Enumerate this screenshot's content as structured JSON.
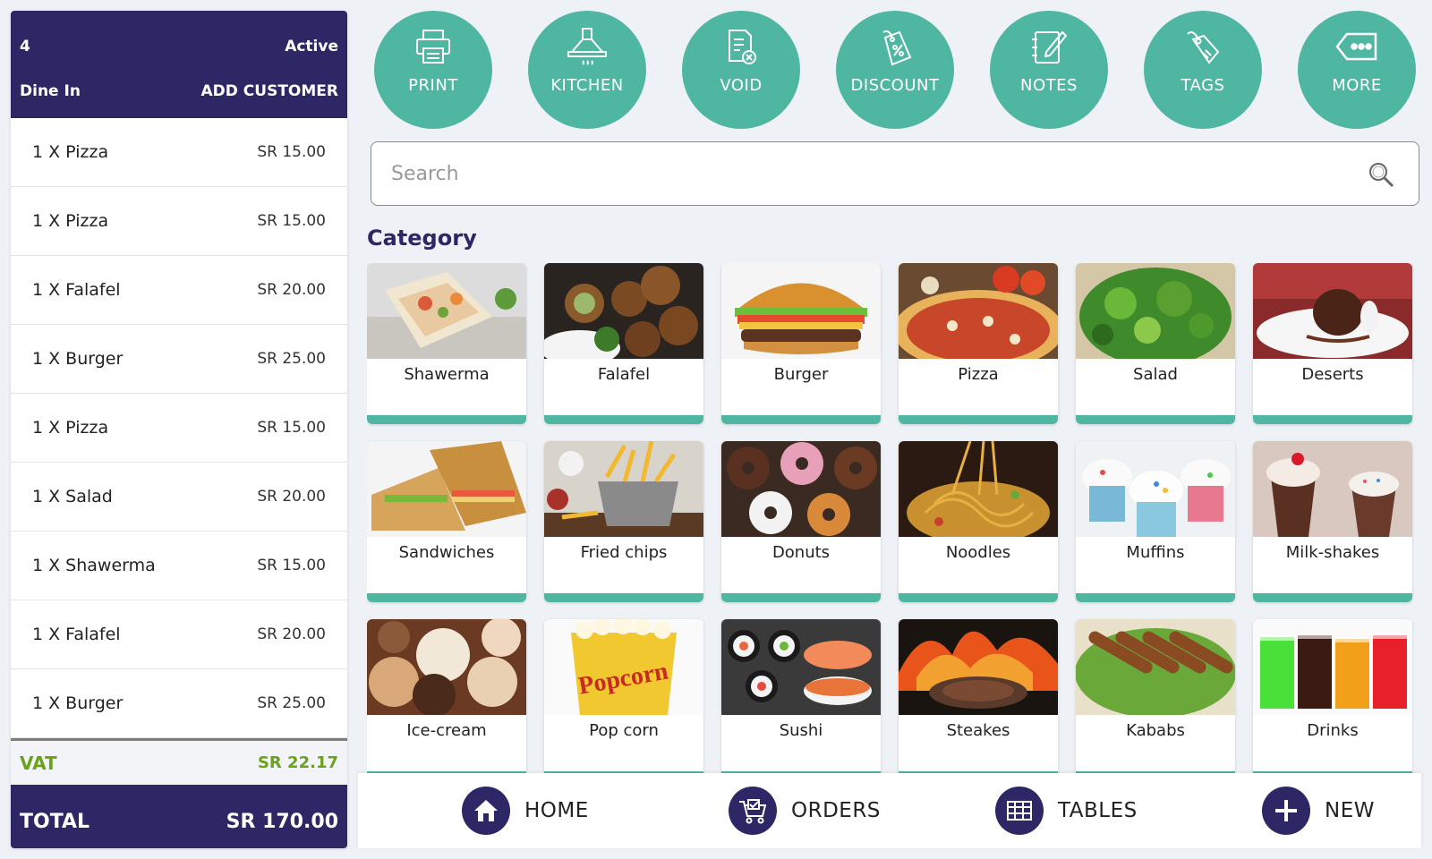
{
  "order": {
    "number": "4",
    "status": "Active",
    "type": "Dine In",
    "add_customer": "ADD CUSTOMER",
    "items": [
      {
        "label": "1 X Pizza",
        "price": "SR 15.00"
      },
      {
        "label": "1 X Pizza",
        "price": "SR 15.00"
      },
      {
        "label": "1 X Falafel",
        "price": "SR 20.00"
      },
      {
        "label": "1 X Burger",
        "price": "SR 25.00"
      },
      {
        "label": "1 X Pizza",
        "price": "SR 15.00"
      },
      {
        "label": "1 X Salad",
        "price": "SR 20.00"
      },
      {
        "label": "1 X Shawerma",
        "price": "SR 15.00"
      },
      {
        "label": "1 X Falafel",
        "price": "SR 20.00"
      },
      {
        "label": "1 X Burger",
        "price": "SR 25.00"
      }
    ],
    "vat_label": "VAT",
    "vat_amount": "SR 22.17",
    "total_label": "TOTAL",
    "total_amount": "SR 170.00"
  },
  "actions": [
    {
      "label": "PRINT",
      "icon": "printer-icon"
    },
    {
      "label": "KITCHEN",
      "icon": "kitchen-hood-icon"
    },
    {
      "label": "VOID",
      "icon": "void-document-icon"
    },
    {
      "label": "DISCOUNT",
      "icon": "discount-tag-icon"
    },
    {
      "label": "NOTES",
      "icon": "notes-icon"
    },
    {
      "label": "TAGS",
      "icon": "tag-icon"
    },
    {
      "label": "MORE",
      "icon": "more-icon"
    }
  ],
  "search": {
    "placeholder": "Search",
    "icon": "search-icon"
  },
  "category_title": "Category",
  "categories": [
    {
      "name": "Shawerma"
    },
    {
      "name": "Falafel"
    },
    {
      "name": "Burger"
    },
    {
      "name": "Pizza"
    },
    {
      "name": "Salad"
    },
    {
      "name": "Deserts"
    },
    {
      "name": "Sandwiches"
    },
    {
      "name": "Fried chips"
    },
    {
      "name": "Donuts"
    },
    {
      "name": "Noodles"
    },
    {
      "name": "Muffins"
    },
    {
      "name": "Milk-shakes"
    },
    {
      "name": "Ice-cream"
    },
    {
      "name": "Pop corn"
    },
    {
      "name": "Sushi"
    },
    {
      "name": "Steakes"
    },
    {
      "name": "Kababs"
    },
    {
      "name": "Drinks"
    }
  ],
  "nav": [
    {
      "label": "HOME",
      "icon": "home-icon"
    },
    {
      "label": "ORDERS",
      "icon": "orders-cart-icon"
    },
    {
      "label": "TABLES",
      "icon": "tables-grid-icon"
    },
    {
      "label": "NEW",
      "icon": "plus-icon"
    }
  ],
  "colors": {
    "primary": "#2d2766",
    "accent": "#4fb7a1",
    "vat": "#6aa21d",
    "background": "#eef1f5"
  }
}
